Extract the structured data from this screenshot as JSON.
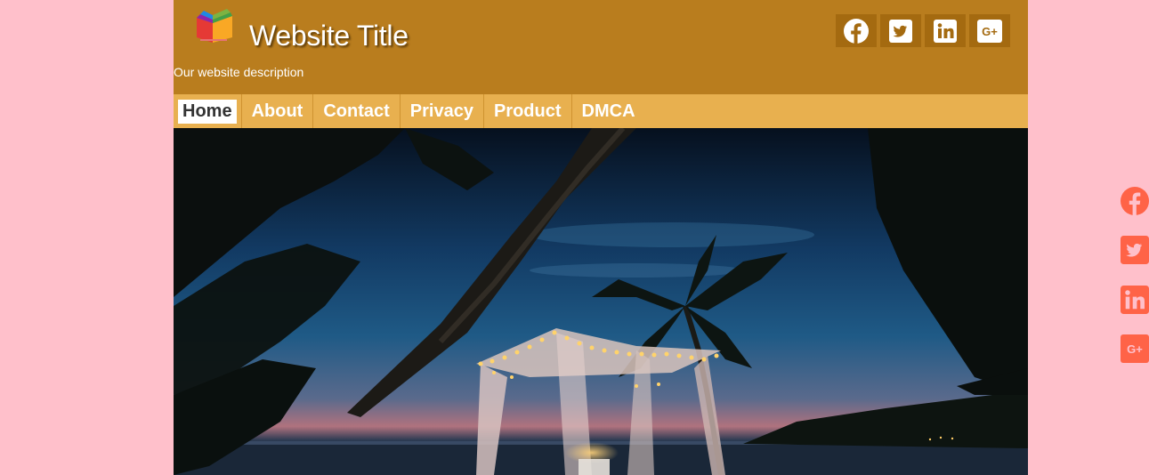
{
  "header": {
    "title": "Website Title",
    "description": "Our website description",
    "logo_icon": "book-logo-icon",
    "bg_color": "#b97d1e",
    "social": [
      {
        "icon": "facebook-icon"
      },
      {
        "icon": "twitter-icon"
      },
      {
        "icon": "linkedin-icon"
      },
      {
        "icon": "google-plus-icon",
        "label": "G+"
      }
    ]
  },
  "nav": {
    "bg_color": "#e8b04f",
    "items": [
      {
        "label": "Home",
        "active": true
      },
      {
        "label": "About"
      },
      {
        "label": "Contact"
      },
      {
        "label": "Privacy"
      },
      {
        "label": "Product"
      },
      {
        "label": "DMCA"
      }
    ]
  },
  "hero": {
    "image": "beach-canopy-night-photo",
    "alt": "Lit canopy on a tropical beach at dusk with palm trees"
  },
  "side_social": {
    "color": "#ff6347",
    "items": [
      {
        "icon": "facebook-icon"
      },
      {
        "icon": "twitter-icon"
      },
      {
        "icon": "linkedin-icon"
      },
      {
        "icon": "google-plus-icon",
        "label": "G+"
      }
    ]
  },
  "page_bg": "#ffc0cb"
}
